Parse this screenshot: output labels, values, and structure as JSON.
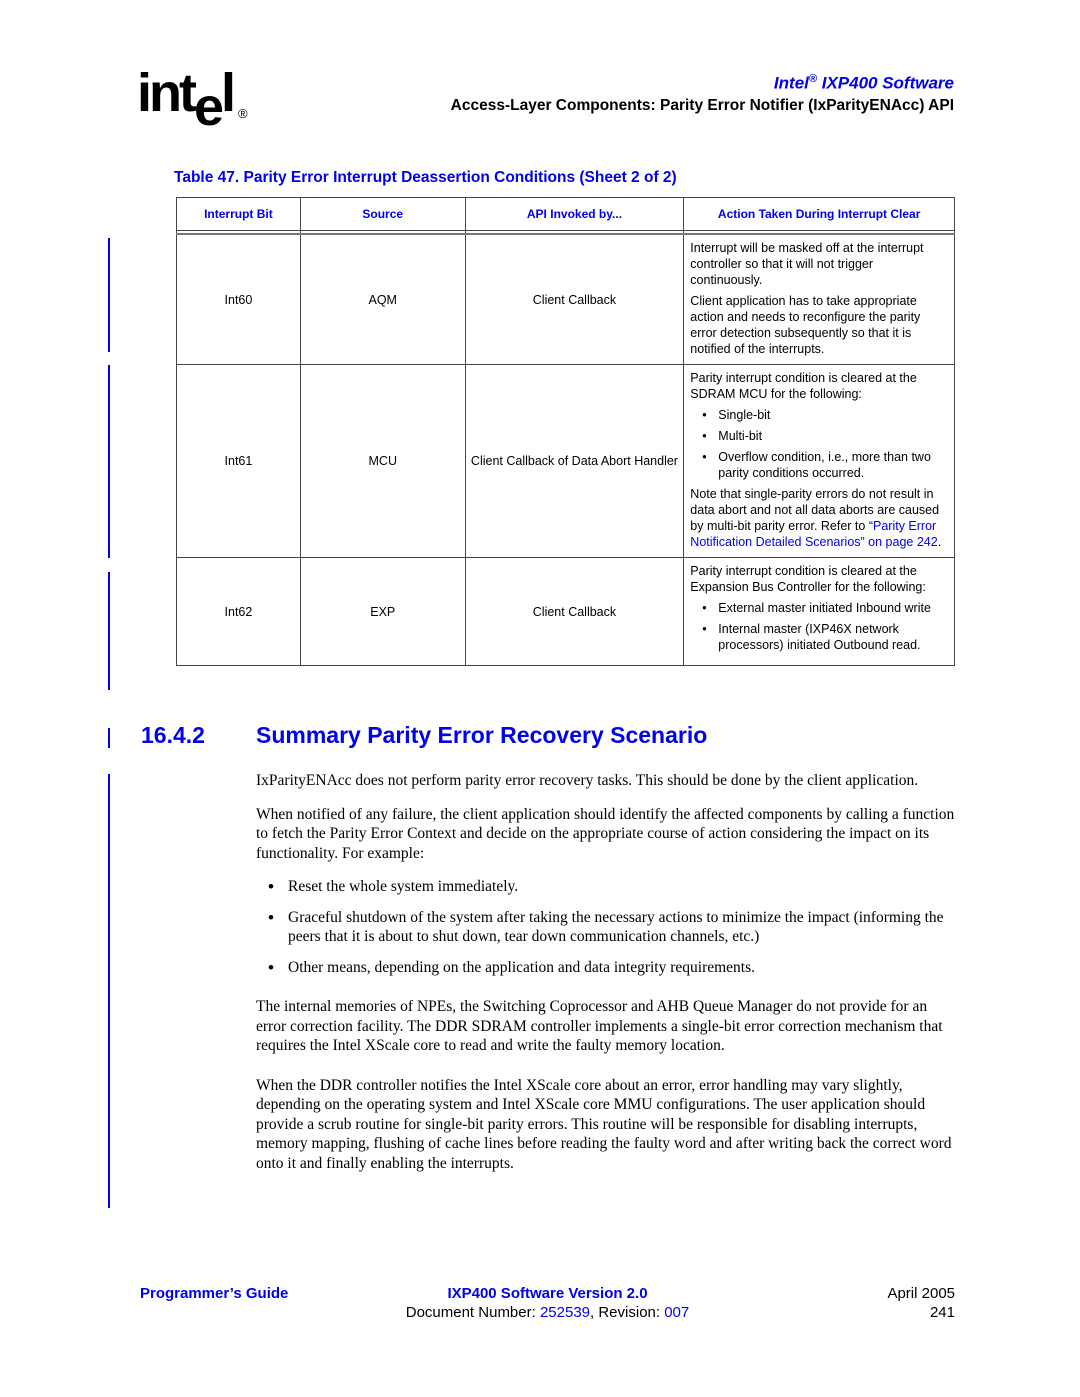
{
  "header": {
    "logo_text": "intel",
    "logo_registered": "®",
    "product_brand": "Intel",
    "product_registered": "®",
    "product_name": "IXP400 Software",
    "section_title": "Access-Layer Components: Parity Error Notifier (IxParityENAcc) API"
  },
  "table": {
    "caption": "Table 47.  Parity Error Interrupt Deassertion Conditions (Sheet 2 of 2)",
    "columns": [
      "Interrupt Bit",
      "Source",
      "API Invoked by...",
      "Action Taken During Interrupt Clear"
    ],
    "rows": [
      {
        "interrupt_bit": "Int60",
        "source": "AQM",
        "api_invoked_by": "Client Callback",
        "action": {
          "para1": "Interrupt will be masked off at the interrupt controller so that it will not trigger continuously.",
          "para2": "Client application has to take appropriate action and needs to reconfigure the parity error detection subsequently so that it is notified of the interrupts."
        }
      },
      {
        "interrupt_bit": "Int61",
        "source": "MCU",
        "api_invoked_by": "Client Callback of Data Abort Handler",
        "action": {
          "intro": "Parity interrupt condition is cleared at the SDRAM MCU for the following:",
          "bullets": [
            "Single-bit",
            "Multi-bit",
            "Overflow condition, i.e., more than two parity conditions occurred."
          ],
          "note": "Note that single-parity errors do not result in data abort and not all data aborts are caused by multi-bit parity error. Refer to ",
          "link_text": "“Parity Error Notification Detailed Scenarios” on page 242",
          "note_end": "."
        }
      },
      {
        "interrupt_bit": "Int62",
        "source": "EXP",
        "api_invoked_by": "Client Callback",
        "action": {
          "intro": "Parity interrupt condition is cleared at the Expansion Bus Controller for the following:",
          "bullets": [
            "External master initiated Inbound write",
            "Internal master (IXP46X network processors) initiated Outbound read."
          ]
        }
      }
    ]
  },
  "section": {
    "number": "16.4.2",
    "title": "Summary Parity Error Recovery Scenario",
    "paragraphs": [
      "IxParityENAcc does not perform parity error recovery tasks. This should be done by the client application.",
      "When notified of any failure, the client application should identify the affected components by calling a function to fetch the Parity Error Context and decide on the appropriate course of action considering the impact on its functionality.  For example:"
    ],
    "bullets": [
      "Reset the whole system immediately.",
      "Graceful shutdown of the system after taking the necessary actions to minimize the impact (informing the peers that it is about to shut down, tear down communication channels, etc.)",
      "Other means, depending on the application and data integrity requirements."
    ],
    "paragraphs_after": [
      "The internal memories of NPEs, the Switching Coprocessor and AHB Queue Manager do not provide for an error correction facility. The DDR SDRAM controller implements a single-bit error correction mechanism that requires the Intel XScale core to read and write the faulty memory location.",
      "When the DDR controller notifies the Intel XScale core about an error, error handling may vary slightly, depending on the operating system and Intel XScale core MMU configurations. The user application should provide a scrub routine for single-bit parity errors. This routine will be responsible for disabling interrupts, memory mapping, flushing of cache lines before reading the faulty word and after writing back the correct word onto it and finally enabling the interrupts."
    ]
  },
  "footer": {
    "guide": "Programmer’s Guide",
    "version": "IXP400 Software Version 2.0",
    "doc_number_label": "Document Number: ",
    "doc_number": "252539",
    "revision_label": ", Revision: ",
    "revision": "007",
    "date": "April 2005",
    "page": "241"
  },
  "colors": {
    "accent_blue": "#0000ee",
    "text": "#000000",
    "table_border": "#444444"
  }
}
